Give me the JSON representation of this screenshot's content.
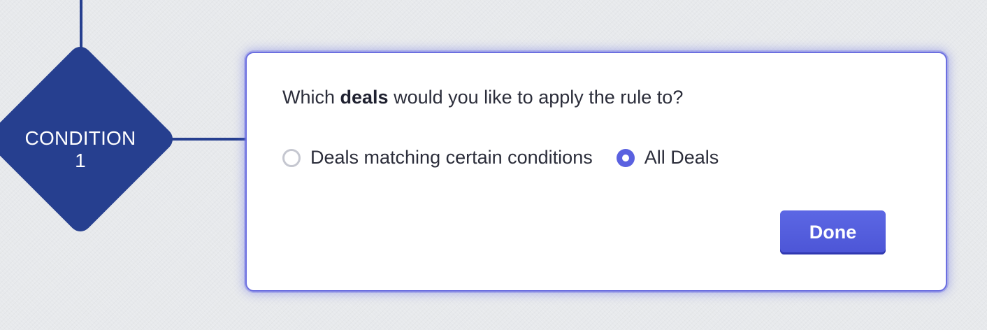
{
  "flow": {
    "condition_node": {
      "label_line1": "CONDITION",
      "label_line2": "1"
    }
  },
  "dialog": {
    "question": {
      "prefix": "Which ",
      "emphasis": "deals",
      "suffix": " would you like to apply the rule to?"
    },
    "options": [
      {
        "label": "Deals matching certain conditions",
        "selected": false
      },
      {
        "label": "All Deals",
        "selected": true
      }
    ],
    "done_label": "Done"
  },
  "colors": {
    "node": "#263f8f",
    "accent": "#5a61e0",
    "card_border": "#6c6fe0",
    "background": "#e7e9ec"
  },
  "icons": {
    "unselected_radio": "radio-unchecked",
    "selected_radio": "radio-checked"
  }
}
